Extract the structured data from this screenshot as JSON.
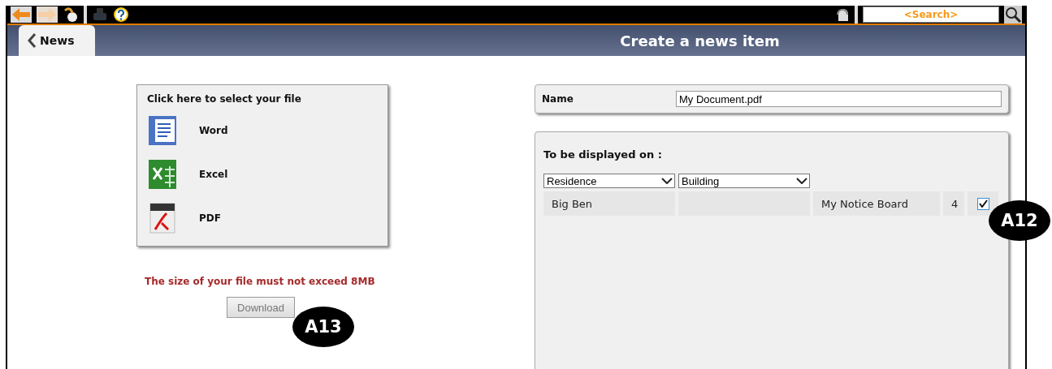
{
  "toolbar": {
    "search": {
      "placeholder": "<Search>"
    }
  },
  "header": {
    "back_tab": {
      "label": "News",
      "selected": true
    },
    "title": "Create a news item"
  },
  "file_picker": {
    "heading": "Click here to select your file",
    "options": [
      {
        "kind": "word",
        "label": "Word"
      },
      {
        "kind": "excel",
        "label": "Excel"
      },
      {
        "kind": "pdf",
        "label": "PDF"
      }
    ]
  },
  "size_warning": "The size of your file must not exceed 8MB",
  "download_button": {
    "label": "Download",
    "disabled": true
  },
  "name_field": {
    "label": "Name",
    "value": "My Document.pdf"
  },
  "display": {
    "heading": "To be displayed on :",
    "filters": [
      {
        "value": "Residence"
      },
      {
        "value": "Building"
      }
    ],
    "rows": [
      {
        "column_1": "Big Ben",
        "column_2": "",
        "column_3": "My Notice Board",
        "column_4": "4",
        "checked": true
      }
    ]
  },
  "annotations": [
    {
      "label": "A13"
    },
    {
      "label": "A12"
    }
  ]
}
